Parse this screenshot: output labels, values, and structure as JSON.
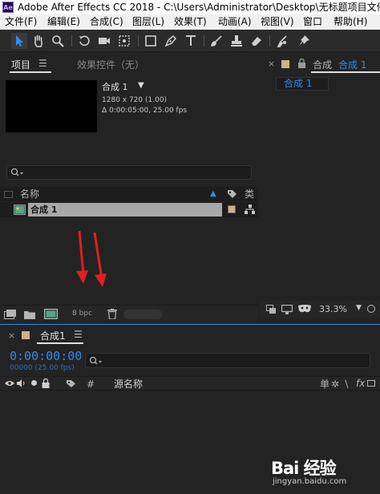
{
  "window": {
    "title": "Adobe After Effects CC 2018 - C:\\Users\\Administrator\\Desktop\\无标题项目文件",
    "logo_text": "Ae"
  },
  "menu": [
    "文件(F)",
    "编辑(E)",
    "合成(C)",
    "图层(L)",
    "效果(T)",
    "动画(A)",
    "视图(V)",
    "窗口",
    "帮助(H)"
  ],
  "project_panel": {
    "tab_project": "项目",
    "tab_effects": "效果控件（无）",
    "comp_name": "合成 1",
    "comp_resolution": "1280 x 720 (1.00)",
    "comp_duration": "Δ 0:00:05:00, 25.00 fps",
    "column_name": "名称",
    "column_type": "类",
    "items": [
      {
        "name": "合成 1",
        "label_color": "#c9b48a"
      }
    ],
    "bpc": "8 bpc"
  },
  "comp_panel": {
    "tab_label": "合成",
    "tab_comp": "合成 1",
    "comp_button": "合成 1",
    "zoom": "33.3%"
  },
  "timeline_panel": {
    "tab_label": "合成1",
    "timecode": "0:00:00:00",
    "frames": "00000 (25.00 fps)",
    "column_source": "源名称",
    "column_hash": "#",
    "column_switch_glyph": "单"
  },
  "watermark": {
    "logo": "Bai 经验",
    "sub": "jingyan.baidu.com"
  },
  "colors": {
    "accent_blue": "#2d8ceb",
    "arrow_red": "#e02020",
    "label_tan": "#c9b48a"
  }
}
